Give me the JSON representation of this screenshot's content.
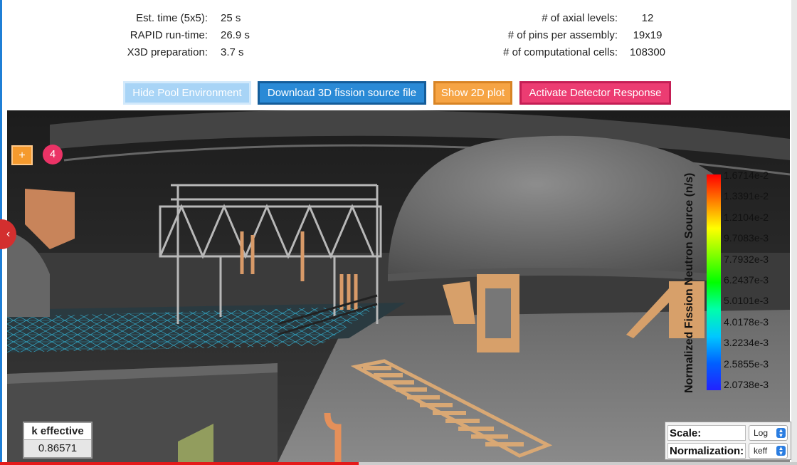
{
  "stats_left": [
    {
      "label": "Est. time  (5x5):",
      "value": "25 s"
    },
    {
      "label": "RAPID run-time:",
      "value": "26.9 s"
    },
    {
      "label": "X3D preparation:",
      "value": "3.7 s"
    }
  ],
  "stats_right": [
    {
      "label": "# of axial levels:",
      "value": "12"
    },
    {
      "label": "# of pins per assembly:",
      "value": "19x19"
    },
    {
      "label": "# of computational cells:",
      "value": "108300"
    }
  ],
  "buttons": {
    "hide_pool": "Hide Pool Environment",
    "download": "Download 3D fission source file",
    "show_plot": "Show 2D plot",
    "detector": "Activate Detector Response"
  },
  "viewer": {
    "plus_label": "+",
    "badge_count": "4",
    "side_tab_label": "‹",
    "progress": 0.45
  },
  "colorbar": {
    "title": "Normalized Fission Neutron Source (n/s)",
    "labels": [
      "1.6714e-2",
      "1.3391e-2",
      "1.2104e-2",
      "9.7083e-3",
      "7.7932e-3",
      "6.2437e-3",
      "5.0101e-3",
      "4.0178e-3",
      "3.2234e-3",
      "2.5855e-3",
      "2.0738e-3"
    ]
  },
  "keff": {
    "label": "k effective",
    "value": "0.86571"
  },
  "controls": {
    "scale_label": "Scale:",
    "scale_value": "Log",
    "norm_label": "Normalization:",
    "norm_value": "keff"
  }
}
